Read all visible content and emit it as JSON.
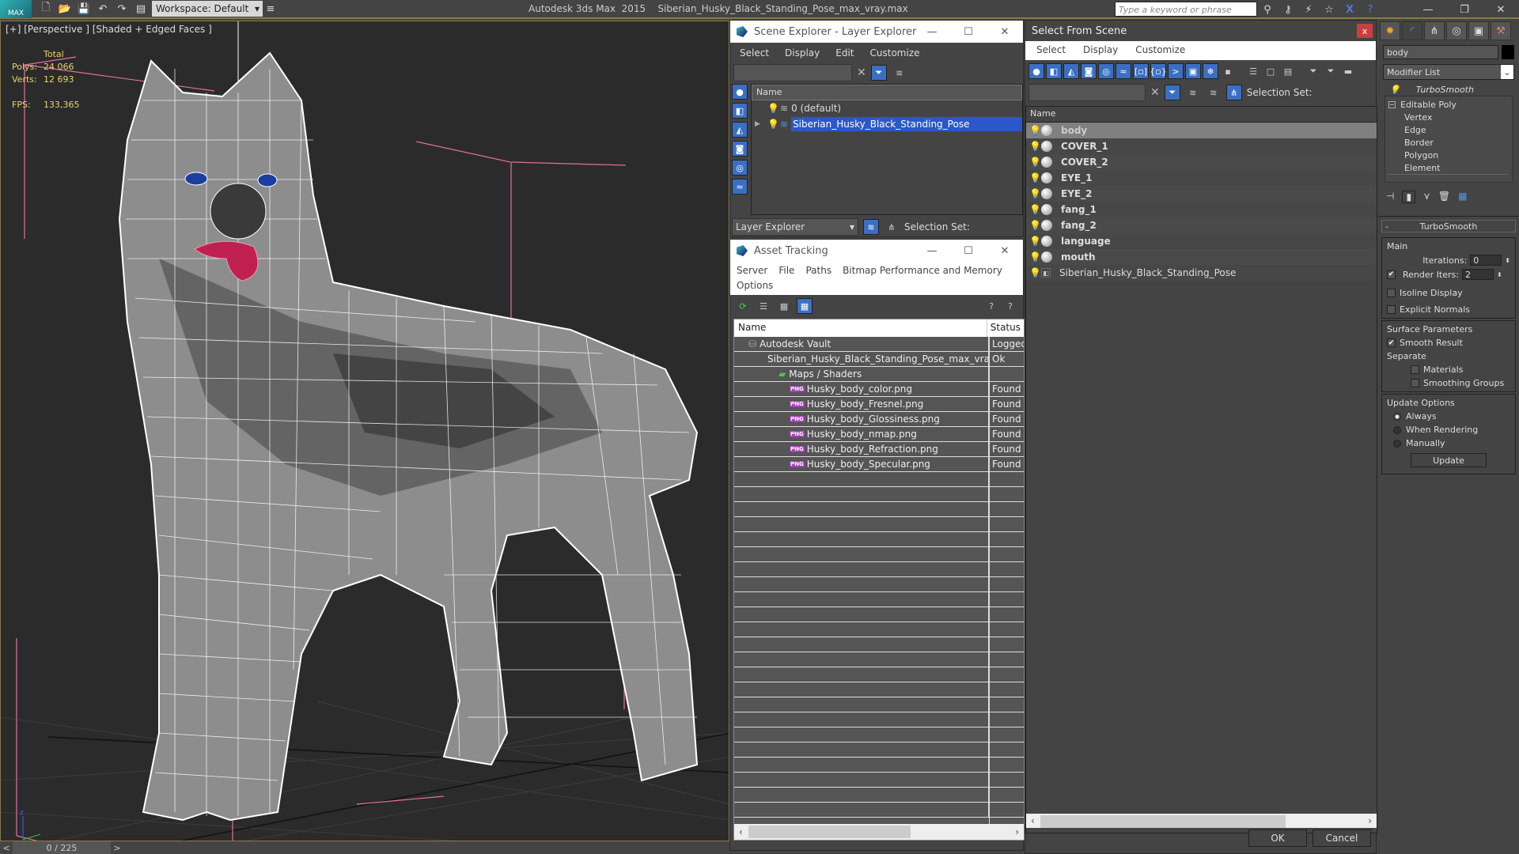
{
  "titlebar": {
    "app_logo": "MAX",
    "workspace": "Workspace: Default",
    "app_name": "Autodesk 3ds Max  2015",
    "file_name": "Siberian_Husky_Black_Standing_Pose_max_vray.max",
    "search_placeholder": "Type a keyword or phrase",
    "icons": [
      "new-icon",
      "open-icon",
      "save-icon",
      "undo-icon",
      "redo-icon",
      "project-icon"
    ],
    "help_tools": [
      "binoculars-icon",
      "key-icon",
      "satellite-icon",
      "star-icon",
      "exchange-icon",
      "help-icon"
    ]
  },
  "viewport": {
    "label": "[+] [Perspective ] [Shaded + Edged Faces ]",
    "stats": {
      "header": "Total",
      "polys_label": "Polys:",
      "polys_value": "24 066",
      "verts_label": "Verts:",
      "verts_value": "12 693",
      "fps_label": "FPS:",
      "fps_value": "133,365"
    },
    "colors": {
      "mesh": "#ffffff",
      "eyes": "#1a3fa0",
      "tongue": "#c02050",
      "box": "#e070a0"
    }
  },
  "timeline": {
    "prev": "<",
    "frame": "0 / 225",
    "next": ">"
  },
  "scene_explorer": {
    "title": "Scene Explorer - Layer Explorer",
    "menu": [
      "Select",
      "Display",
      "Edit",
      "Customize"
    ],
    "column": "Name",
    "rows": [
      {
        "name": "0 (default)",
        "selected": false
      },
      {
        "name": "Siberian_Husky_Black_Standing_Pose",
        "selected": true
      }
    ],
    "bottom_dropdown": "Layer Explorer",
    "selection_set_label": "Selection Set:"
  },
  "asset_tracking": {
    "title": "Asset Tracking",
    "menu": [
      "Server",
      "File",
      "Paths",
      "Bitmap Performance and Memory",
      "Options"
    ],
    "columns": [
      "Name",
      "Status"
    ],
    "rows": [
      {
        "name": "Autodesk Vault",
        "status": "Logged",
        "indent": 1,
        "icon": "vault-icon"
      },
      {
        "name": "Siberian_Husky_Black_Standing_Pose_max_vray....",
        "status": "Ok",
        "indent": 2,
        "icon": "max-file-icon"
      },
      {
        "name": "Maps / Shaders",
        "status": "",
        "indent": 3,
        "icon": "maps-icon"
      },
      {
        "name": "Husky_body_color.png",
        "status": "Found",
        "indent": 4,
        "icon": "png-icon"
      },
      {
        "name": "Husky_body_Fresnel.png",
        "status": "Found",
        "indent": 4,
        "icon": "png-icon"
      },
      {
        "name": "Husky_body_Glossiness.png",
        "status": "Found",
        "indent": 4,
        "icon": "png-icon"
      },
      {
        "name": "Husky_body_nmap.png",
        "status": "Found",
        "indent": 4,
        "icon": "png-icon"
      },
      {
        "name": "Husky_body_Refraction.png",
        "status": "Found",
        "indent": 4,
        "icon": "png-icon"
      },
      {
        "name": "Husky_body_Specular.png",
        "status": "Found",
        "indent": 4,
        "icon": "png-icon"
      }
    ]
  },
  "select_from_scene": {
    "title": "Select From Scene",
    "close": "x",
    "menu": [
      "Select",
      "Display",
      "Customize"
    ],
    "selection_set_label": "Selection Set:",
    "column": "Name",
    "rows": [
      {
        "name": "body",
        "selected": true
      },
      {
        "name": "COVER_1",
        "selected": false
      },
      {
        "name": "COVER_2",
        "selected": false
      },
      {
        "name": "EYE_1",
        "selected": false
      },
      {
        "name": "EYE_2",
        "selected": false
      },
      {
        "name": "fang_1",
        "selected": false
      },
      {
        "name": "fang_2",
        "selected": false
      },
      {
        "name": "language",
        "selected": false
      },
      {
        "name": "mouth",
        "selected": false
      },
      {
        "name": "Siberian_Husky_Black_Standing_Pose",
        "selected": false,
        "group": true
      }
    ],
    "ok": "OK",
    "cancel": "Cancel"
  },
  "command_panel": {
    "tabs": [
      "create-icon",
      "modify-icon",
      "hierarchy-icon",
      "motion-icon",
      "display-icon",
      "utilities-icon"
    ],
    "object_name": "body",
    "object_color": "#000000",
    "modifier_list": "Modifier List",
    "stack": {
      "top": "TurboSmooth",
      "base": "Editable Poly",
      "subobjects": [
        "Vertex",
        "Edge",
        "Border",
        "Polygon",
        "Element"
      ]
    },
    "turbosmooth": {
      "title": "TurboSmooth",
      "collapse": "-",
      "main_label": "Main",
      "iterations_label": "Iterations:",
      "iterations": "0",
      "render_iters_label": "Render Iters:",
      "render_iters": "2",
      "render_iters_checked": true,
      "isoline_label": "Isoline Display",
      "isoline_checked": false,
      "explicit_normals_label": "Explicit Normals",
      "explicit_normals_checked": false,
      "surface_label": "Surface Parameters",
      "smooth_result_label": "Smooth Result",
      "smooth_result_checked": true,
      "separate_label": "Separate",
      "materials_label": "Materials",
      "smoothing_groups_label": "Smoothing Groups",
      "update_label": "Update Options",
      "update_options": [
        "Always",
        "When Rendering",
        "Manually"
      ],
      "update_selected": "Always",
      "update_button": "Update"
    }
  }
}
